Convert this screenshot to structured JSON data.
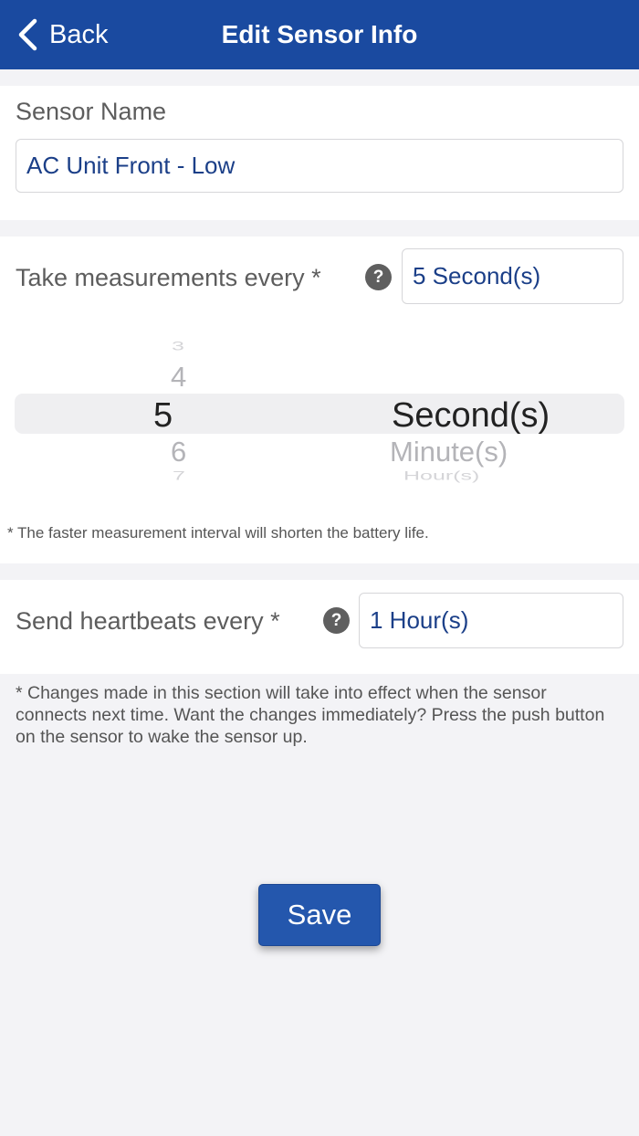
{
  "nav": {
    "back_label": "Back",
    "title": "Edit Sensor Info"
  },
  "sensor_name": {
    "label": "Sensor Name",
    "value": "AC Unit Front - Low"
  },
  "measurement": {
    "label": "Take measurements every *",
    "help": "?",
    "value": "5 Second(s)",
    "picker": {
      "numbers": [
        "3",
        "4",
        "5",
        "6",
        "7"
      ],
      "units": [
        "Second(s)",
        "Minute(s)",
        "Hour(s)"
      ],
      "selected_number": "5",
      "selected_unit": "Second(s)"
    },
    "note": "* The faster measurement interval will shorten the battery life."
  },
  "heartbeat": {
    "label": "Send heartbeats every *",
    "help": "?",
    "value": "1 Hour(s)"
  },
  "section_note": "* Changes made in this section will take into effect when the sensor connects next time.  Want the changes immediately? Press the push button on the sensor to wake the sensor up.",
  "save_label": "Save",
  "colors": {
    "nav_bg": "#1a4aa0",
    "accent_text": "#1b3f88",
    "button_bg": "#2457ad",
    "page_bg": "#f3f3f6"
  }
}
